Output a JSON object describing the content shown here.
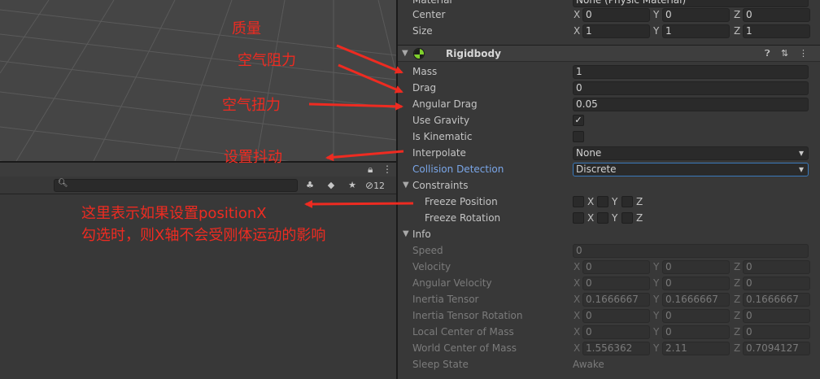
{
  "panel": {
    "visible_count": "12"
  },
  "inspector": {
    "collider": {
      "material_label": "Material",
      "material_value": "None (Physic Material)",
      "center_label": "Center",
      "center": {
        "x": "0",
        "y": "0",
        "z": "0"
      },
      "size_label": "Size",
      "size": {
        "x": "1",
        "y": "1",
        "z": "1"
      }
    },
    "rigidbody": {
      "title": "Rigidbody",
      "mass_label": "Mass",
      "mass": "1",
      "drag_label": "Drag",
      "drag": "0",
      "angular_drag_label": "Angular Drag",
      "angular_drag": "0.05",
      "use_gravity_label": "Use Gravity",
      "use_gravity": true,
      "is_kinematic_label": "Is Kinematic",
      "is_kinematic": false,
      "interpolate_label": "Interpolate",
      "interpolate": "None",
      "collision_detection_label": "Collision Detection",
      "collision_detection": "Discrete",
      "constraints_label": "Constraints",
      "freeze_position_label": "Freeze Position",
      "freeze_rotation_label": "Freeze Rotation",
      "axis_x": "X",
      "axis_y": "Y",
      "axis_z": "Z",
      "info_label": "Info",
      "speed_label": "Speed",
      "speed": "0",
      "velocity_label": "Velocity",
      "velocity": {
        "x": "0",
        "y": "0",
        "z": "0"
      },
      "angular_velocity_label": "Angular Velocity",
      "angular_velocity": {
        "x": "0",
        "y": "0",
        "z": "0"
      },
      "inertia_tensor_label": "Inertia Tensor",
      "inertia_tensor": {
        "x": "0.1666667",
        "y": "0.1666667",
        "z": "0.1666667"
      },
      "inertia_tensor_rotation_label": "Inertia Tensor Rotation",
      "inertia_tensor_rotation": {
        "x": "0",
        "y": "0",
        "z": "0"
      },
      "local_center_label": "Local Center of Mass",
      "local_center": {
        "x": "0",
        "y": "0",
        "z": "0"
      },
      "world_center_label": "World Center of Mass",
      "world_center": {
        "x": "1.556362",
        "y": "2.11",
        "z": "0.7094127"
      },
      "sleep_state_label": "Sleep State",
      "sleep_state": "Awake"
    }
  },
  "annotations": {
    "mass": "质量",
    "drag": "空气阻力",
    "angular_drag": "空气扭力",
    "interpolate": "设置抖动",
    "freeze_line1": "这里表示如果设置positionX",
    "freeze_line2": "勾选时，则X轴不会受刚体运动的影响"
  },
  "colors": {
    "annotation": "#ee2b21",
    "link_label": "#7aa6e8",
    "rigidbody_icon": "#7fd02c"
  }
}
